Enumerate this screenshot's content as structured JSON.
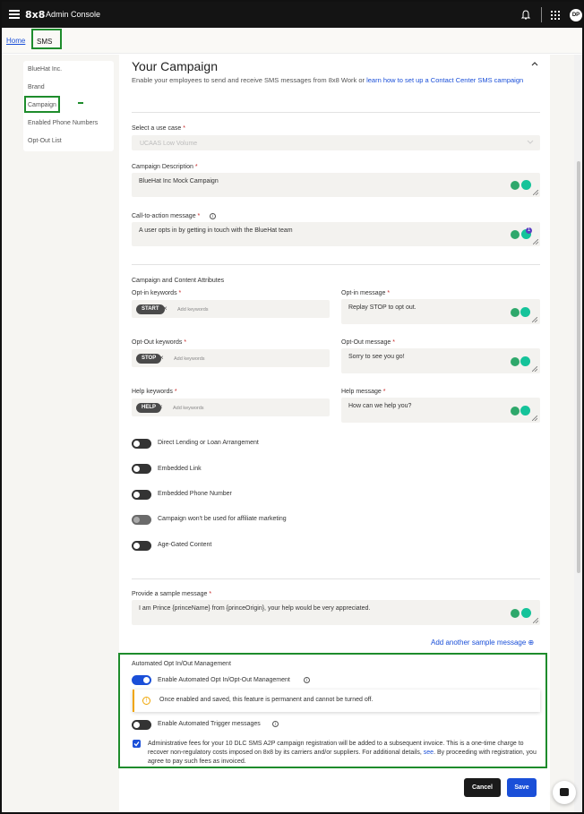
{
  "header": {
    "logo": "8x8",
    "app_title": "Admin Console",
    "avatar_initials": "DP"
  },
  "breadcrumb": {
    "home": "Home",
    "current": "SMS"
  },
  "sidebar": {
    "items": [
      "BlueHat Inc.",
      "Brand",
      "Campaign",
      "Enabled Phone Numbers",
      "Opt-Out List"
    ],
    "active": "Campaign"
  },
  "campaign": {
    "title": "Your Campaign",
    "intro_text": "Enable your employees to send and receive SMS messages from 8x8 Work or ",
    "intro_link": "learn how to set up a Contact Center SMS campaign",
    "use_case_label": "Select a use case",
    "use_case_value": "UCAAS Low Volume",
    "description_label": "Campaign Description",
    "description_value": "BlueHat Inc Mock Campaign",
    "cta_label": "Call-to-action message",
    "cta_value": "A user opts in by getting in touch with the BlueHat team",
    "attributes_heading": "Campaign and Content Attributes",
    "optin_keywords_label": "Opt-in keywords",
    "optin_keyword_chip": "START",
    "optin_message_label": "Opt-in message",
    "optin_message_value": "Replay STOP to opt out.",
    "optout_keywords_label": "Opt-Out keywords",
    "optout_keyword_chip": "STOP",
    "optout_message_label": "Opt-Out message",
    "optout_message_value": "Sorry to see you go!",
    "help_keywords_label": "Help keywords",
    "help_keyword_chip": "HELP",
    "help_message_label": "Help message",
    "help_message_value": "How can we help you?",
    "add_keywords_placeholder": "Add keywords",
    "toggles": [
      "Direct Lending or Loan Arrangement",
      "Embedded Link",
      "Embedded Phone Number",
      "Campaign won't be used for affiliate marketing",
      "Age-Gated Content"
    ],
    "sample_label": "Provide a sample message",
    "sample_value": "I am Prince {princeName} from {princeOrigin}, your help would be very appreciated.",
    "add_sample": "Add another sample message",
    "grammarly_badge": "1"
  },
  "auto_management": {
    "heading": "Automated Opt In/Out Management",
    "enable_label": "Enable Automated Opt In/Opt-Out Management",
    "warning": "Once enabled and saved, this feature is permanent and cannot be turned off.",
    "trigger_label": "Enable Automated Trigger messages",
    "fees_text_1": "Administrative fees for your 10 DLC SMS A2P campaign registration will be added to a subsequent invoice. This is a one-time charge to recover non-regulatory costs imposed on 8x8 by its carriers and/or suppliers. For additional details, ",
    "fees_link": "see",
    "fees_text_2": ". By proceeding with registration, you agree to pay such fees as invoiced."
  },
  "actions": {
    "cancel": "Cancel",
    "save": "Save"
  },
  "required_marker": "*"
}
